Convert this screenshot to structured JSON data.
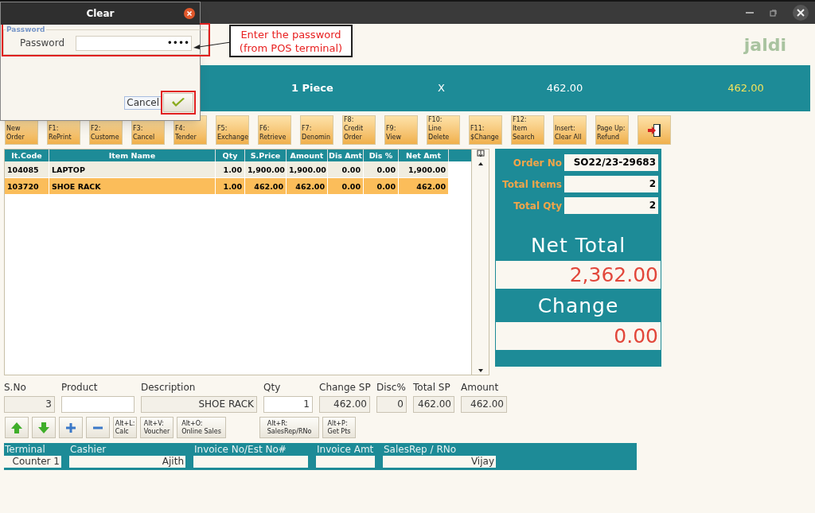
{
  "dialog": {
    "title": "Clear",
    "group_label": "Password",
    "field_label": "Password",
    "password": "••••",
    "cancel_label": "Cancel"
  },
  "annotation": {
    "lines": [
      "Enter the password",
      "(from POS terminal)"
    ]
  },
  "logo": "jaldi",
  "scan_bar": {
    "quantity": "1 Piece",
    "multiply": "X",
    "price": "462.00",
    "total": "462.00"
  },
  "function_keys": [
    {
      "kind": "text",
      "label": "New\nOrder"
    },
    {
      "kind": "text",
      "label": "F1:\nRePrint"
    },
    {
      "kind": "text",
      "label": "F2:\nCustome"
    },
    {
      "kind": "text",
      "label": "F3:\nCancel"
    },
    {
      "kind": "text",
      "label": "F4:\nTender"
    },
    {
      "kind": "text",
      "label": "F5:\nExchange"
    },
    {
      "kind": "text",
      "label": "F6:\nRetrieve"
    },
    {
      "kind": "text",
      "label": "F7:\nDenomin"
    },
    {
      "kind": "text",
      "label": "F8:\nCredit\nOrder"
    },
    {
      "kind": "text",
      "label": "F9:\nView"
    },
    {
      "kind": "text",
      "label": "F10:\nLine\nDelete"
    },
    {
      "kind": "text",
      "label": "F11:\n$Change"
    },
    {
      "kind": "text",
      "label": "F12:\nItem\nSearch"
    },
    {
      "kind": "text",
      "label": "Insert:\nClear All"
    },
    {
      "kind": "text",
      "label": "Page Up:\nRefund"
    },
    {
      "kind": "exit"
    }
  ],
  "table": {
    "columns": [
      "It.Code",
      "Item Name",
      "Qty",
      "S.Price",
      "Amount",
      "Dis Amt",
      "Dis %",
      "Net Amt"
    ],
    "rows": [
      {
        "selected": false,
        "cells": [
          "104085",
          "LAPTOP",
          "1.00",
          "1,900.00",
          "1,900.00",
          "0.00",
          "0.00",
          "1,900.00"
        ]
      },
      {
        "selected": true,
        "cells": [
          "103720",
          "SHOE RACK",
          "1.00",
          "462.00",
          "462.00",
          "0.00",
          "0.00",
          "462.00"
        ]
      }
    ]
  },
  "summary": {
    "fields": [
      {
        "label": "Order No",
        "value": "SO22/23-29683"
      },
      {
        "label": "Total Items",
        "value": "2"
      },
      {
        "label": "Total Qty",
        "value": "2"
      }
    ],
    "net_total_label": "Net Total",
    "net_total": "2,362.00",
    "change_label": "Change",
    "change": "0.00"
  },
  "entry": [
    {
      "label": "S.No",
      "value": "3",
      "editable": false
    },
    {
      "label": "Product",
      "editable": true
    },
    {
      "label": "Description",
      "value": "SHOE RACK",
      "editable": false
    },
    {
      "label": "Qty",
      "value": "1",
      "editable": true
    },
    {
      "label": "Change SP",
      "value": "462.00",
      "editable": false
    },
    {
      "label": "Disc%",
      "value": "0",
      "editable": false
    },
    {
      "label": "Total SP",
      "value": "462.00",
      "editable": false
    },
    {
      "label": "Amount",
      "value": "462.00",
      "editable": false
    }
  ],
  "actions": [
    {
      "kind": "up"
    },
    {
      "kind": "down"
    },
    {
      "kind": "plus"
    },
    {
      "kind": "minus"
    },
    {
      "kind": "text",
      "label": "Alt+L:\nCalc"
    },
    {
      "kind": "text",
      "label": "Alt+V:\nVoucher"
    },
    {
      "kind": "text",
      "label": "Alt+O:\nOnline Sales"
    },
    {
      "kind": "text",
      "label": "Alt+R:\nSalesRep/RNo"
    },
    {
      "kind": "text",
      "label": "Alt+P:\nGet Pts"
    }
  ],
  "footer": [
    {
      "label": "Terminal",
      "value": "Counter 1"
    },
    {
      "label": "Cashier",
      "value": "Ajith"
    },
    {
      "label": "Invoice No/Est No#"
    },
    {
      "label": "Invoice Amt"
    },
    {
      "label": "SalesRep / RNo",
      "value": "Vijay"
    }
  ]
}
